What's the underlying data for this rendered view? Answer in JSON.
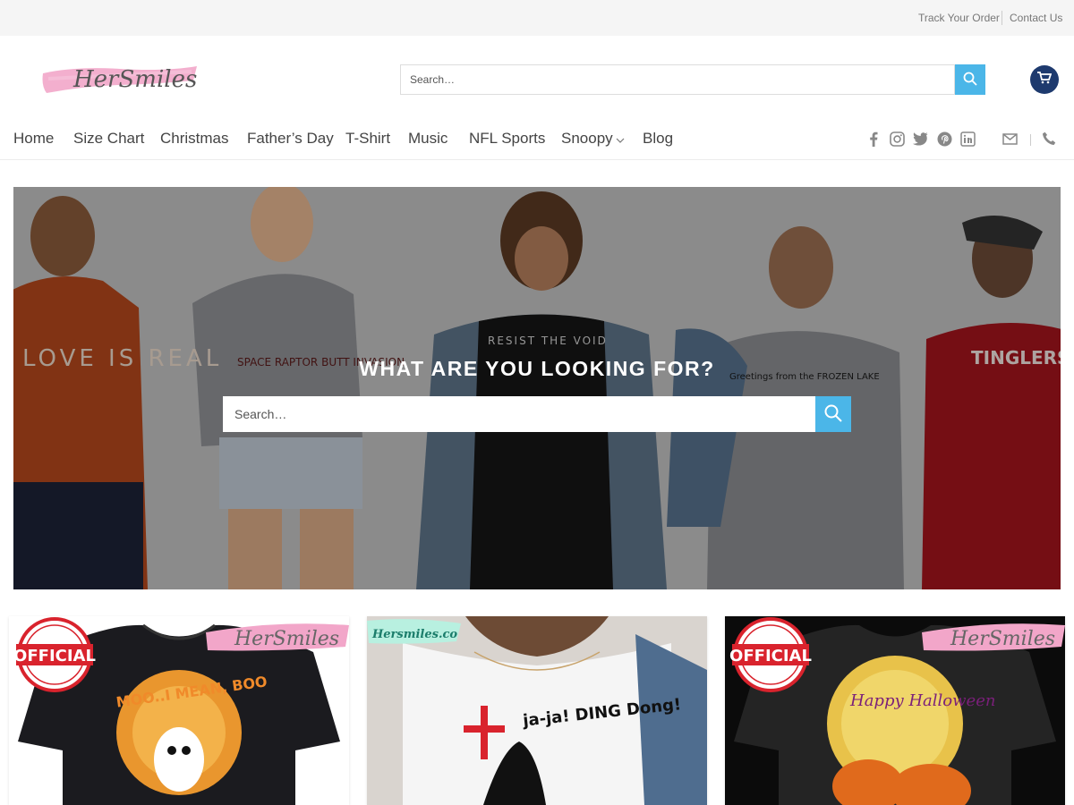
{
  "topbar": {
    "track_order": "Track Your Order",
    "contact_us": "Contact Us"
  },
  "header": {
    "logo_text": "HerSmiles",
    "search_placeholder": "Search…",
    "icons": {
      "search": "search-icon",
      "cart": "cart-icon"
    }
  },
  "nav": {
    "items": [
      "Home",
      "Size Chart",
      "Christmas",
      "Father’s Day",
      "T-Shirt",
      "Music",
      "NFL Sports",
      "Snoopy",
      "Blog"
    ],
    "social_icons": [
      "facebook-icon",
      "instagram-icon",
      "twitter-icon",
      "pinterest-icon",
      "linkedin-icon",
      "email-icon",
      "phone-icon"
    ]
  },
  "hero": {
    "title": "What are you looking for?",
    "search_placeholder": "Search…",
    "shirt_texts": {
      "left": "LOVE IS REAL",
      "second": "SPACE RAPTOR BUTT INVASION",
      "center": "RESIST THE VOID",
      "fourth": "Greetings from the FROZEN LAKE",
      "right": "TINGLERS"
    }
  },
  "products": [
    {
      "badge": "OFFICIAL",
      "watermark": "HerSmiles",
      "shirt_text": "MOO..I MEAN, BOO"
    },
    {
      "watermark": "Hersmiles.co",
      "shirt_text": "ja-ja! DING Dong!"
    },
    {
      "badge": "OFFICIAL",
      "watermark": "HerSmiles",
      "shirt_text": "Happy Halloween"
    }
  ],
  "colors": {
    "accent": "#4bb6e8",
    "cart": "#1e3a6e",
    "logo_brush": "#f2a6c9",
    "badge_red": "#d9232d"
  }
}
